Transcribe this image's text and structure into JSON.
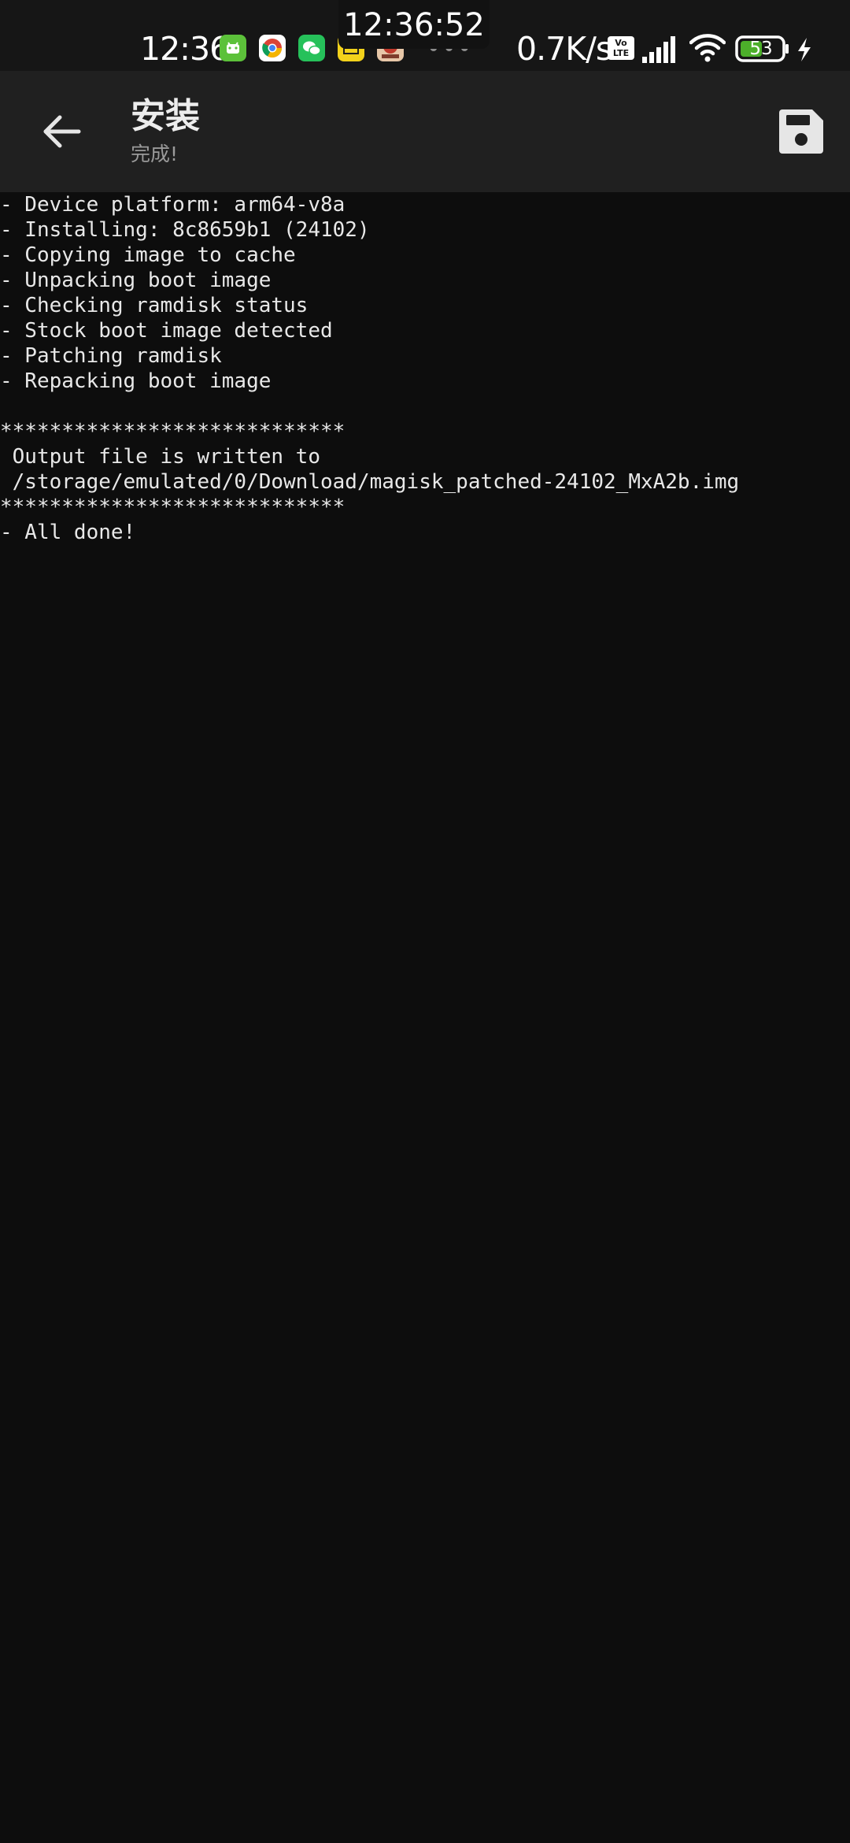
{
  "status_bar": {
    "time": "12:36",
    "clock_overlay": "12:36:52",
    "more_indicator": "•••",
    "network_speed": "0.7K/s",
    "volte_label_top": "Vo",
    "volte_label_bottom": "LTE",
    "battery_level": "53",
    "notification_icons": [
      "android-icon",
      "chrome-icon",
      "wechat-icon",
      "notification-app-icon",
      "game-app-icon"
    ]
  },
  "toolbar": {
    "title": "安装",
    "subtitle": "完成!",
    "back_icon": "arrow-left-icon",
    "save_icon": "save-icon"
  },
  "console": {
    "lines": [
      "- Device platform: arm64-v8a",
      "- Installing: 8c8659b1 (24102)",
      "- Copying image to cache",
      "- Unpacking boot image",
      "- Checking ramdisk status",
      "- Stock boot image detected",
      "- Patching ramdisk",
      "- Repacking boot image",
      "",
      "****************************",
      " Output file is written to",
      " /storage/emulated/0/Download/magisk_patched-24102_MxA2b.img",
      "****************************",
      "- All done!"
    ]
  },
  "colors": {
    "background": "#0d0d0d",
    "toolbar": "#202020",
    "status_bar": "#161616",
    "text": "#e8e8e8",
    "subtitle": "#9a9a9a",
    "battery_fill": "#4caf2a"
  }
}
